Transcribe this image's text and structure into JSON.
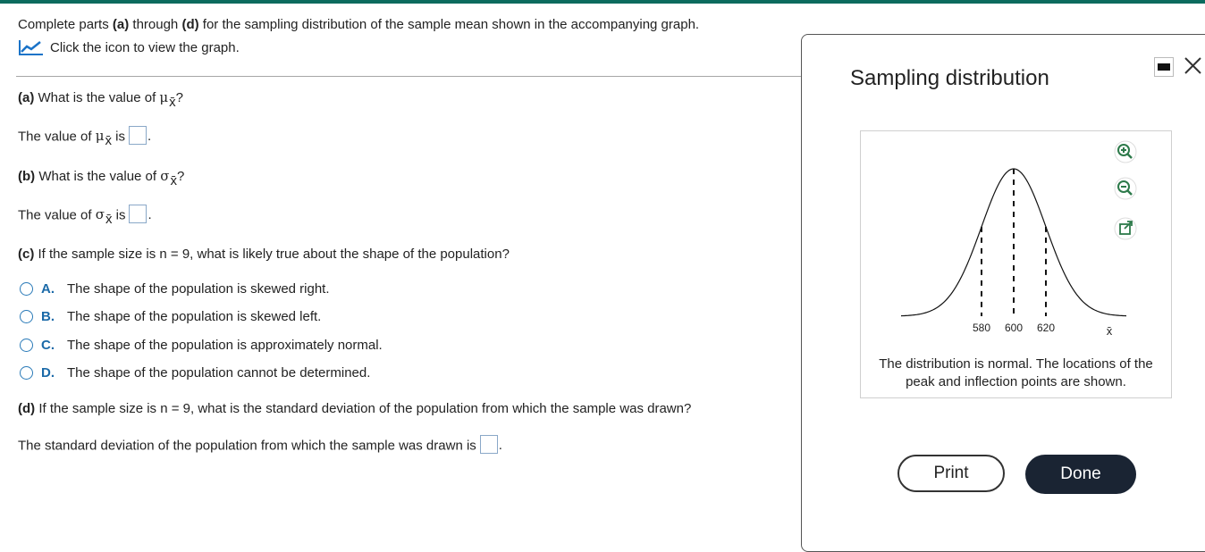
{
  "intro": {
    "text_before_a": "Complete parts ",
    "part_a": "(a)",
    "text_through": " through ",
    "part_d": "(d)",
    "text_after": " for the sampling distribution of the sample mean shown in the accompanying graph.",
    "graph_link": "Click the icon to view the graph."
  },
  "symbols": {
    "mu": "μ",
    "sigma": "σ",
    "xbar": "x̄"
  },
  "part_a": {
    "label": "(a)",
    "question_prefix": " What is the value of ",
    "question_suffix": "?",
    "answer_prefix": "The value of ",
    "answer_is": " is",
    "answer_value": ""
  },
  "part_b": {
    "label": "(b)",
    "question_prefix": " What is the value of ",
    "question_suffix": "?",
    "answer_prefix": "The value of ",
    "answer_is": " is",
    "answer_value": ""
  },
  "part_c": {
    "label": "(c)",
    "question": " If the sample size is n = 9, what is likely true about the shape of the population?",
    "choices": [
      {
        "letter": "A.",
        "text": "The shape of the population is skewed right."
      },
      {
        "letter": "B.",
        "text": "The shape of the population is skewed left."
      },
      {
        "letter": "C.",
        "text": "The shape of the population is approximately normal."
      },
      {
        "letter": "D.",
        "text": "The shape of the population cannot be determined."
      }
    ]
  },
  "part_d": {
    "label": "(d)",
    "question": " If the sample size is n = 9, what is the standard deviation of the population from which the sample was drawn?",
    "answer_prefix": "The standard deviation of the population from which the sample was drawn is",
    "answer_value": ""
  },
  "panel": {
    "title": "Sampling distribution",
    "caption_line1": "The distribution is normal. The locations of the",
    "caption_line2": "peak and inflection points are shown.",
    "print_label": "Print",
    "done_label": "Done",
    "icons": {
      "minimize": "minimize-icon",
      "close": "close-icon",
      "zoom_in": "zoom-in-icon",
      "zoom_out": "zoom-out-icon",
      "popout": "popout-icon",
      "graph": "graph-icon"
    }
  },
  "chart_data": {
    "type": "line",
    "title": "",
    "xlabel": "x̄",
    "ylabel": "",
    "mean": 600,
    "sd": 20,
    "ticks": [
      580,
      600,
      620
    ],
    "marked_x": [
      580,
      600,
      620
    ],
    "xlim": [
      530,
      670
    ],
    "grid": false
  },
  "colors": {
    "accent": "#1b6aa8",
    "radio_border": "#2a7ab8",
    "top_bar": "#0b6b5e",
    "done_bg": "#1a2433",
    "graph_icon": "#1a73c8"
  }
}
